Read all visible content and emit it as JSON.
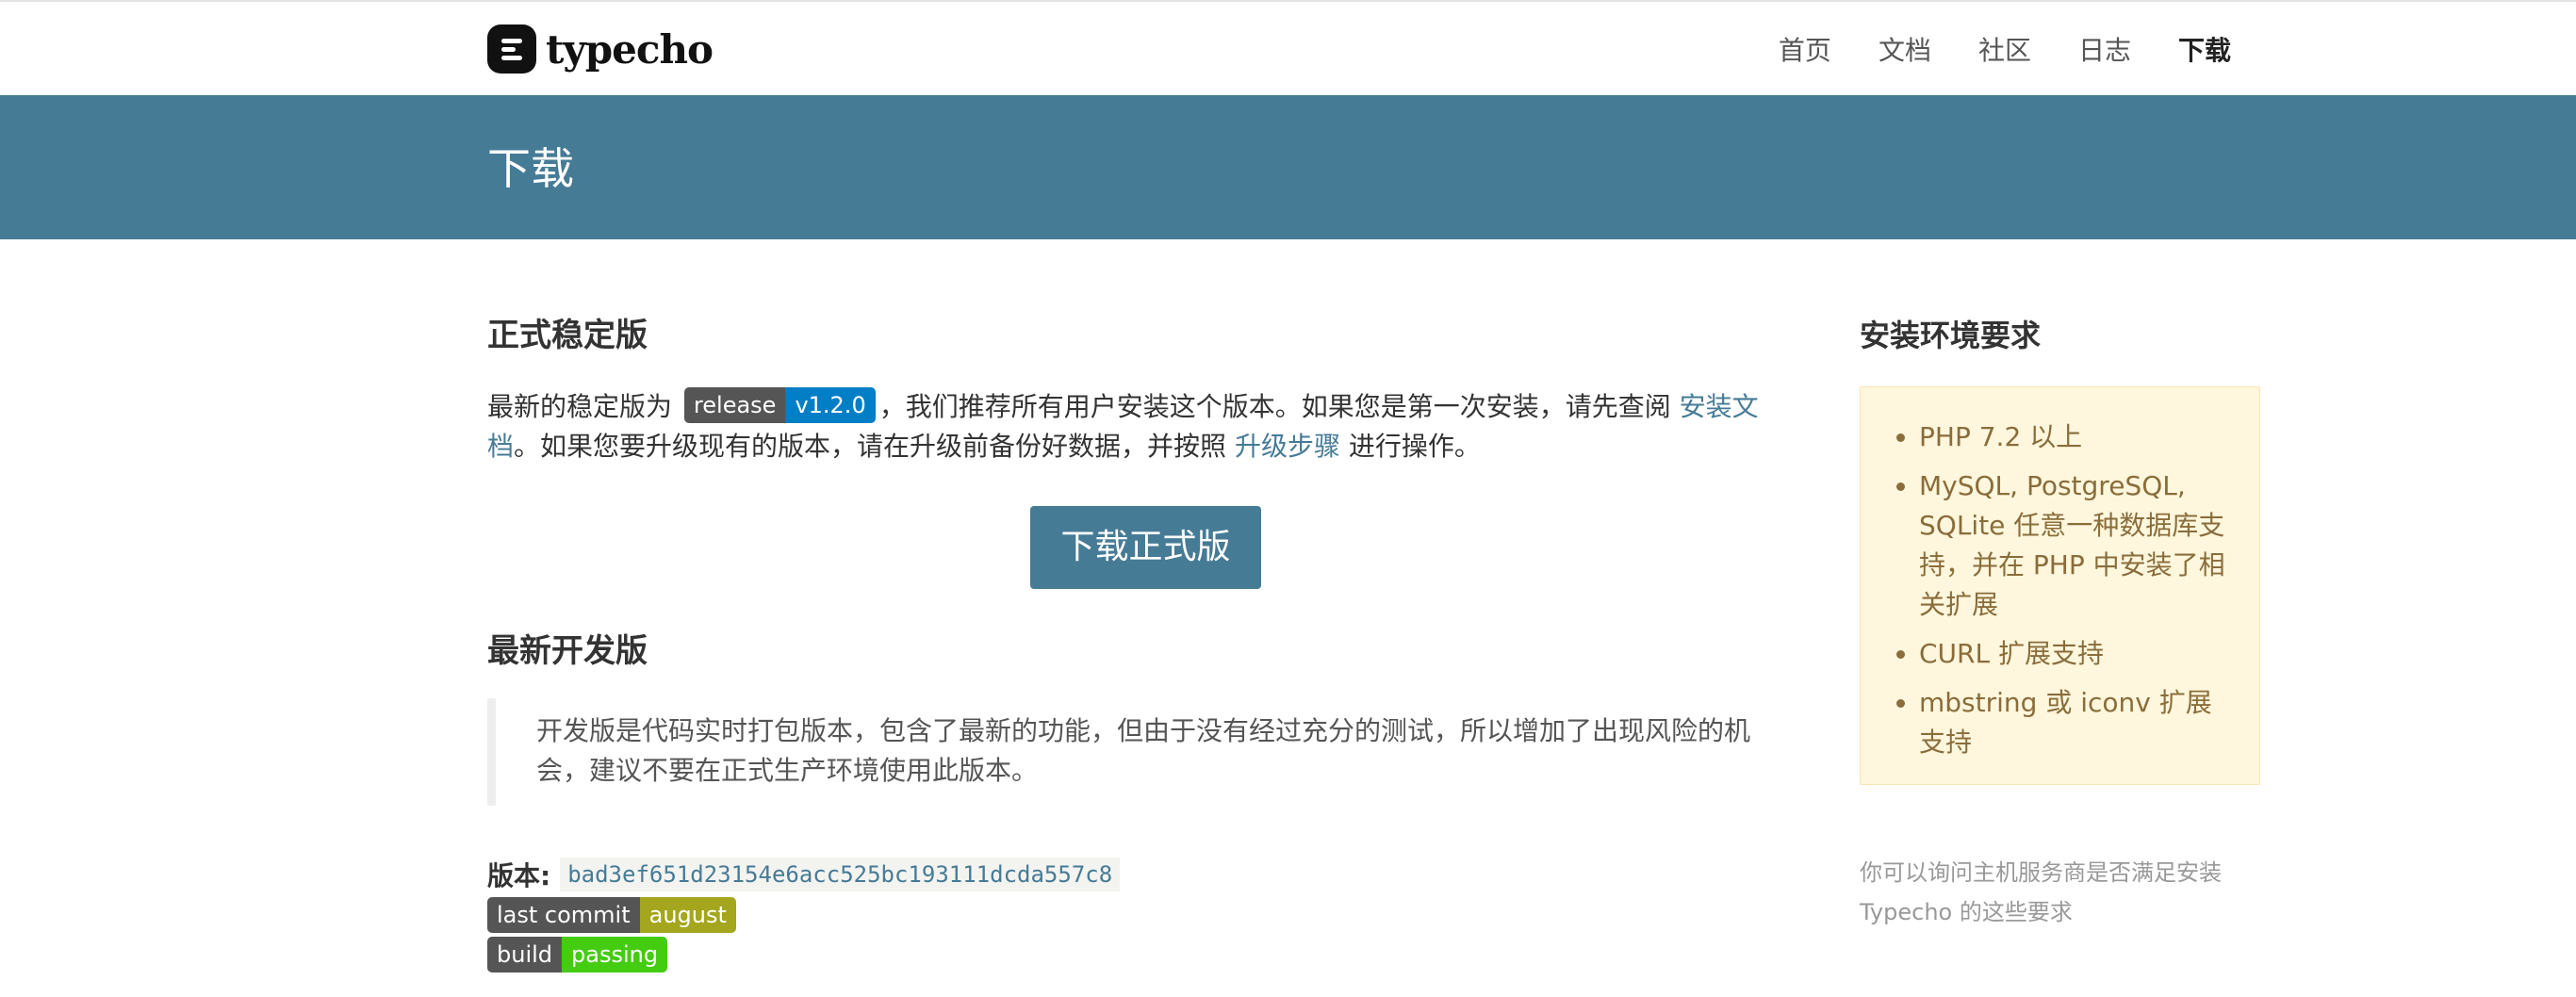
{
  "header": {
    "logo_text": "typecho",
    "nav": [
      {
        "label": "首页"
      },
      {
        "label": "文档"
      },
      {
        "label": "社区"
      },
      {
        "label": "日志"
      },
      {
        "label": "下载"
      }
    ]
  },
  "banner": {
    "title": "下载"
  },
  "stable": {
    "title": "正式稳定版",
    "text_before_badge": "最新的稳定版为",
    "badge_left": "release",
    "badge_right": "v1.2.0",
    "text_after_badge": "，我们推荐所有用户安装这个版本。如果您是第一次安装，请先查阅",
    "install_doc_link": "安装文档",
    "text_line2": "。如果您要升级现有的版本，请在升级前备份好数据，并按照",
    "upgrade_link": "升级步骤",
    "text_end": "进行操作。",
    "download_button": "下载正式版"
  },
  "dev": {
    "title": "最新开发版",
    "notice": "开发版是代码实时打包版本，包含了最新的功能，但由于没有经过充分的测试，所以增加了出现风险的机会，建议不要在正式生产环境使用此版本。",
    "version_label": "版本:",
    "version_hash": "bad3ef651d23154e6acc525bc193111dcda557c8",
    "commit_badge_left": "last commit",
    "commit_badge_right": "august",
    "build_badge_left": "build",
    "build_badge_right": "passing"
  },
  "sidebar": {
    "title": "安装环境要求",
    "requirements": [
      "PHP 7.2 以上",
      "MySQL, PostgreSQL, SQLite 任意一种数据库支持，并在 PHP 中安装了相关扩展",
      "CURL 扩展支持",
      "mbstring 或 iconv 扩展支持"
    ],
    "note": "你可以询问主机服务商是否满足安装 Typecho 的这些要求"
  },
  "colors": {
    "brand": "#467b96",
    "badge_blue": "#007ec6",
    "badge_yellowgreen": "#a4a61d",
    "badge_green": "#44cc11",
    "notice_bg": "#fff7dd",
    "notice_text": "#8a6d3b"
  }
}
